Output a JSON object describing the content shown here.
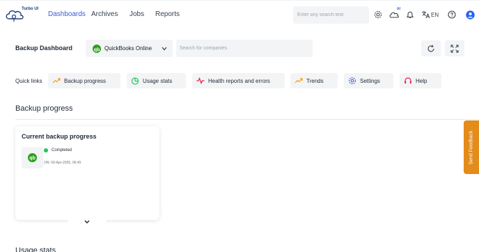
{
  "brand": {
    "logo_text": "Turbo UI"
  },
  "nav": {
    "items": [
      {
        "label": "Dashboards",
        "active": true
      },
      {
        "label": "Archives",
        "active": false
      },
      {
        "label": "Jobs",
        "active": false
      },
      {
        "label": "Reports",
        "active": false
      }
    ]
  },
  "topbar": {
    "search_placeholder": "Enter any search text",
    "ai_badge": "AI",
    "language": "EN",
    "icons": [
      "gear-icon",
      "cloud-ai-icon",
      "bell-icon",
      "translate-icon",
      "help-icon",
      "user-icon"
    ]
  },
  "dashboard": {
    "title": "Backup Dashboard",
    "app_selected": "QuickBooks Online",
    "company_search_placeholder": "Search for companies"
  },
  "quick_links": {
    "label": "Quick links",
    "items": [
      {
        "label": "Backup progress",
        "icon": "trend-up-icon"
      },
      {
        "label": "Usage stats",
        "icon": "pie-chart-icon"
      },
      {
        "label": "Health reports and errors",
        "icon": "pulse-icon"
      },
      {
        "label": "Trends",
        "icon": "trend-up-icon"
      },
      {
        "label": "Settings",
        "icon": "gear-icon"
      },
      {
        "label": "Help",
        "icon": "headset-icon"
      }
    ]
  },
  "sections": {
    "backup_progress": "Backup progress",
    "usage_stats": "Usage stats"
  },
  "backup_card": {
    "title": "Current backup progress",
    "status": "Completed",
    "date": "ON: 09-Apr-2025, 06:45"
  },
  "feedback": {
    "label": "Send Feedback"
  },
  "colors": {
    "accent": "#3b5bdb",
    "quickbooks_green": "#2ca01c",
    "status_green": "#22c55e",
    "feedback_orange": "#e38b1b"
  }
}
